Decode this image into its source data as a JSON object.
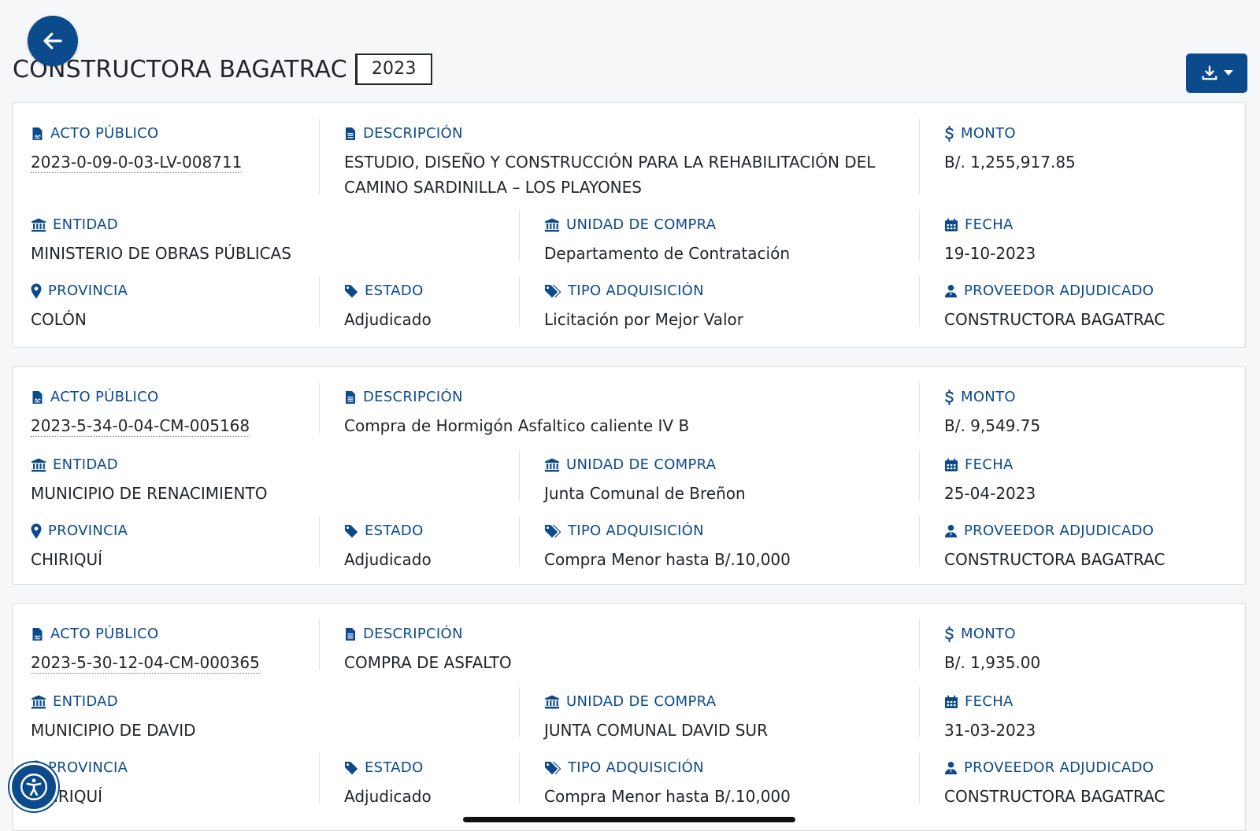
{
  "header": {
    "title": "CONSTRUCTORA BAGATRAC",
    "year": "2023"
  },
  "colors": {
    "accent": "#0b4a8b",
    "text": "#212529",
    "card_border": "#d9dde1"
  },
  "icons": {
    "back": "arrow-left-icon",
    "download": "download-icon",
    "acto": "file-signature-icon",
    "descripcion": "file-text-icon",
    "monto": "dollar-icon",
    "entidad": "bank-icon",
    "unidad": "bank-icon",
    "fecha": "calendar-icon",
    "provincia": "map-pin-icon",
    "estado": "tag-icon",
    "tipo": "tags-icon",
    "proveedor": "user-tie-icon",
    "accessibility": "accessibility-icon"
  },
  "labels": {
    "acto": "ACTO PÚBLICO",
    "descripcion": "DESCRIPCIÓN",
    "monto": "MONTO",
    "entidad": "ENTIDAD",
    "unidad": "UNIDAD DE COMPRA",
    "fecha": "FECHA",
    "provincia": "PROVINCIA",
    "estado": "ESTADO",
    "tipo": "TIPO ADQUISICIÓN",
    "proveedor": "PROVEEDOR ADJUDICADO"
  },
  "records": [
    {
      "acto": "2023-0-09-0-03-LV-008711",
      "descripcion": "ESTUDIO, DISEÑO Y CONSTRUCCIÓN PARA LA REHABILITACIÓN DEL CAMINO SARDINILLA – LOS PLAYONES",
      "monto": "B/. 1,255,917.85",
      "entidad": "MINISTERIO DE OBRAS PÚBLICAS",
      "unidad": "Departamento de Contratación",
      "fecha": "19-10-2023",
      "provincia": "COLÓN",
      "estado": "Adjudicado",
      "tipo": "Licitación por Mejor Valor",
      "proveedor": "CONSTRUCTORA BAGATRAC"
    },
    {
      "acto": "2023-5-34-0-04-CM-005168",
      "descripcion": "Compra de Hormigón Asfaltico caliente IV B",
      "monto": "B/. 9,549.75",
      "entidad": "MUNICIPIO DE RENACIMIENTO",
      "unidad": "Junta Comunal de Breñon",
      "fecha": "25-04-2023",
      "provincia": "CHIRIQUÍ",
      "estado": "Adjudicado",
      "tipo": "Compra Menor hasta B/.10,000",
      "proveedor": "CONSTRUCTORA BAGATRAC"
    },
    {
      "acto": "2023-5-30-12-04-CM-000365",
      "descripcion": "COMPRA DE ASFALTO",
      "monto": "B/. 1,935.00",
      "entidad": "MUNICIPIO DE DAVID",
      "unidad": "JUNTA COMUNAL DAVID SUR",
      "fecha": "31-03-2023",
      "provincia": "CHIRIQUÍ",
      "estado": "Adjudicado",
      "tipo": "Compra Menor hasta B/.10,000",
      "proveedor": "CONSTRUCTORA BAGATRAC"
    }
  ]
}
